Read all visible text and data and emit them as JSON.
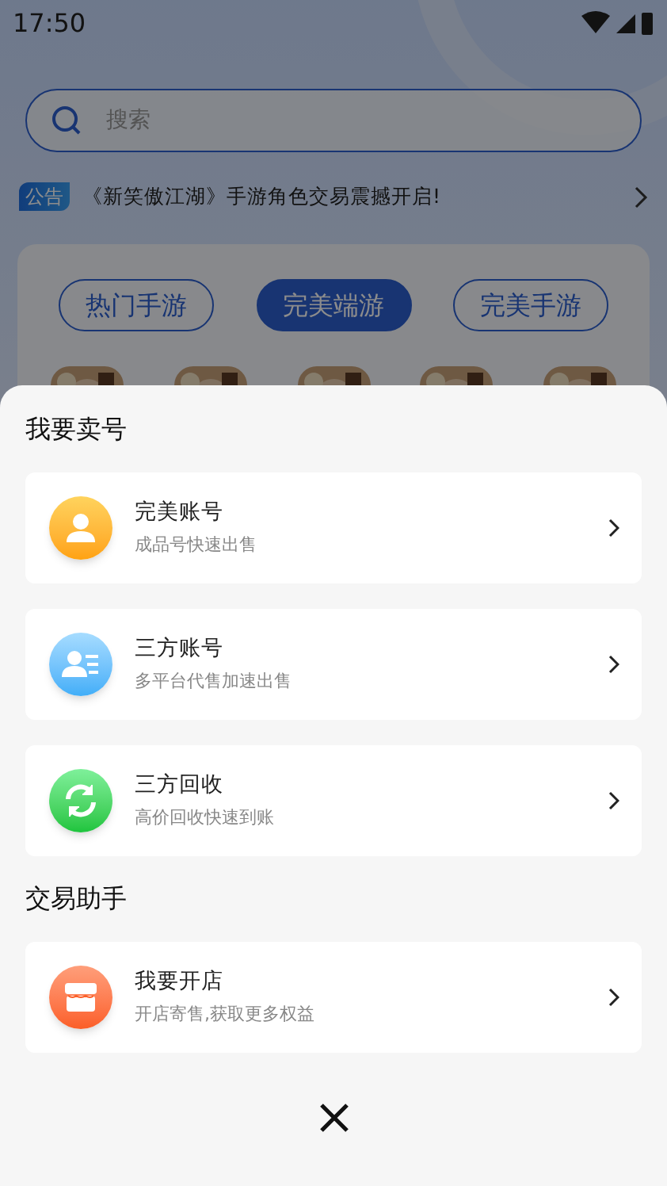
{
  "status_bar": {
    "time": "17:50"
  },
  "search": {
    "placeholder": "搜索"
  },
  "notice": {
    "badge": "公告",
    "text": "《新笑傲江湖》手游角色交易震撼开启!"
  },
  "game_tabs": [
    {
      "label": "热门手游",
      "selected": false
    },
    {
      "label": "完美端游",
      "selected": true
    },
    {
      "label": "完美手游",
      "selected": false
    }
  ],
  "sheet": {
    "sections": [
      {
        "title": "我要卖号",
        "items": [
          {
            "kind": "person",
            "title": "完美账号",
            "subtitle": "成品号快速出售"
          },
          {
            "kind": "contact",
            "title": "三方账号",
            "subtitle": "多平台代售加速出售"
          },
          {
            "kind": "recycle",
            "title": "三方回收",
            "subtitle": "高价回收快速到账"
          }
        ]
      },
      {
        "title": "交易助手",
        "items": [
          {
            "kind": "shop",
            "title": "我要开店",
            "subtitle": "开店寄售,获取更多权益"
          }
        ]
      }
    ]
  }
}
